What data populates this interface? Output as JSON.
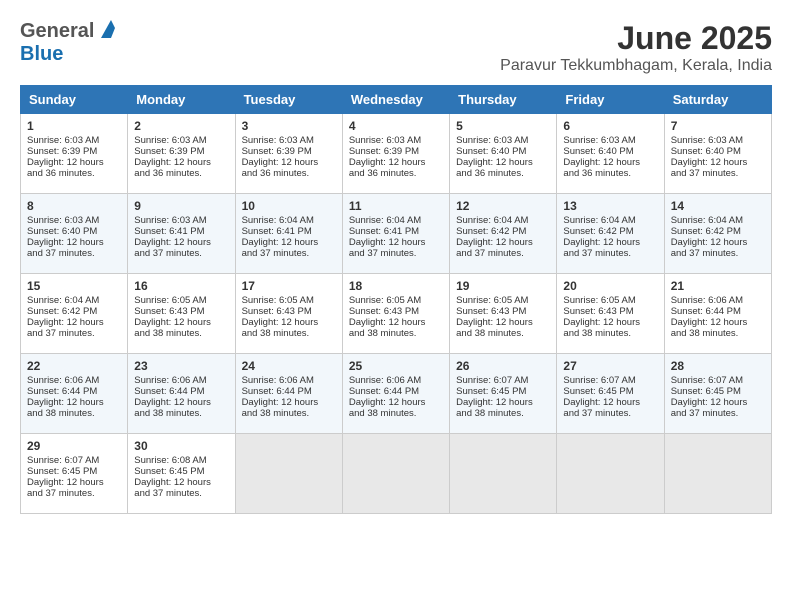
{
  "header": {
    "logo_general": "General",
    "logo_blue": "Blue",
    "title": "June 2025",
    "subtitle": "Paravur Tekkumbhagam, Kerala, India"
  },
  "weekdays": [
    "Sunday",
    "Monday",
    "Tuesday",
    "Wednesday",
    "Thursday",
    "Friday",
    "Saturday"
  ],
  "weeks": [
    [
      {
        "day": 1,
        "lines": [
          "Sunrise: 6:03 AM",
          "Sunset: 6:39 PM",
          "Daylight: 12 hours",
          "and 36 minutes."
        ]
      },
      {
        "day": 2,
        "lines": [
          "Sunrise: 6:03 AM",
          "Sunset: 6:39 PM",
          "Daylight: 12 hours",
          "and 36 minutes."
        ]
      },
      {
        "day": 3,
        "lines": [
          "Sunrise: 6:03 AM",
          "Sunset: 6:39 PM",
          "Daylight: 12 hours",
          "and 36 minutes."
        ]
      },
      {
        "day": 4,
        "lines": [
          "Sunrise: 6:03 AM",
          "Sunset: 6:39 PM",
          "Daylight: 12 hours",
          "and 36 minutes."
        ]
      },
      {
        "day": 5,
        "lines": [
          "Sunrise: 6:03 AM",
          "Sunset: 6:40 PM",
          "Daylight: 12 hours",
          "and 36 minutes."
        ]
      },
      {
        "day": 6,
        "lines": [
          "Sunrise: 6:03 AM",
          "Sunset: 6:40 PM",
          "Daylight: 12 hours",
          "and 36 minutes."
        ]
      },
      {
        "day": 7,
        "lines": [
          "Sunrise: 6:03 AM",
          "Sunset: 6:40 PM",
          "Daylight: 12 hours",
          "and 37 minutes."
        ]
      }
    ],
    [
      {
        "day": 8,
        "lines": [
          "Sunrise: 6:03 AM",
          "Sunset: 6:40 PM",
          "Daylight: 12 hours",
          "and 37 minutes."
        ]
      },
      {
        "day": 9,
        "lines": [
          "Sunrise: 6:03 AM",
          "Sunset: 6:41 PM",
          "Daylight: 12 hours",
          "and 37 minutes."
        ]
      },
      {
        "day": 10,
        "lines": [
          "Sunrise: 6:04 AM",
          "Sunset: 6:41 PM",
          "Daylight: 12 hours",
          "and 37 minutes."
        ]
      },
      {
        "day": 11,
        "lines": [
          "Sunrise: 6:04 AM",
          "Sunset: 6:41 PM",
          "Daylight: 12 hours",
          "and 37 minutes."
        ]
      },
      {
        "day": 12,
        "lines": [
          "Sunrise: 6:04 AM",
          "Sunset: 6:42 PM",
          "Daylight: 12 hours",
          "and 37 minutes."
        ]
      },
      {
        "day": 13,
        "lines": [
          "Sunrise: 6:04 AM",
          "Sunset: 6:42 PM",
          "Daylight: 12 hours",
          "and 37 minutes."
        ]
      },
      {
        "day": 14,
        "lines": [
          "Sunrise: 6:04 AM",
          "Sunset: 6:42 PM",
          "Daylight: 12 hours",
          "and 37 minutes."
        ]
      }
    ],
    [
      {
        "day": 15,
        "lines": [
          "Sunrise: 6:04 AM",
          "Sunset: 6:42 PM",
          "Daylight: 12 hours",
          "and 37 minutes."
        ]
      },
      {
        "day": 16,
        "lines": [
          "Sunrise: 6:05 AM",
          "Sunset: 6:43 PM",
          "Daylight: 12 hours",
          "and 38 minutes."
        ]
      },
      {
        "day": 17,
        "lines": [
          "Sunrise: 6:05 AM",
          "Sunset: 6:43 PM",
          "Daylight: 12 hours",
          "and 38 minutes."
        ]
      },
      {
        "day": 18,
        "lines": [
          "Sunrise: 6:05 AM",
          "Sunset: 6:43 PM",
          "Daylight: 12 hours",
          "and 38 minutes."
        ]
      },
      {
        "day": 19,
        "lines": [
          "Sunrise: 6:05 AM",
          "Sunset: 6:43 PM",
          "Daylight: 12 hours",
          "and 38 minutes."
        ]
      },
      {
        "day": 20,
        "lines": [
          "Sunrise: 6:05 AM",
          "Sunset: 6:43 PM",
          "Daylight: 12 hours",
          "and 38 minutes."
        ]
      },
      {
        "day": 21,
        "lines": [
          "Sunrise: 6:06 AM",
          "Sunset: 6:44 PM",
          "Daylight: 12 hours",
          "and 38 minutes."
        ]
      }
    ],
    [
      {
        "day": 22,
        "lines": [
          "Sunrise: 6:06 AM",
          "Sunset: 6:44 PM",
          "Daylight: 12 hours",
          "and 38 minutes."
        ]
      },
      {
        "day": 23,
        "lines": [
          "Sunrise: 6:06 AM",
          "Sunset: 6:44 PM",
          "Daylight: 12 hours",
          "and 38 minutes."
        ]
      },
      {
        "day": 24,
        "lines": [
          "Sunrise: 6:06 AM",
          "Sunset: 6:44 PM",
          "Daylight: 12 hours",
          "and 38 minutes."
        ]
      },
      {
        "day": 25,
        "lines": [
          "Sunrise: 6:06 AM",
          "Sunset: 6:44 PM",
          "Daylight: 12 hours",
          "and 38 minutes."
        ]
      },
      {
        "day": 26,
        "lines": [
          "Sunrise: 6:07 AM",
          "Sunset: 6:45 PM",
          "Daylight: 12 hours",
          "and 38 minutes."
        ]
      },
      {
        "day": 27,
        "lines": [
          "Sunrise: 6:07 AM",
          "Sunset: 6:45 PM",
          "Daylight: 12 hours",
          "and 37 minutes."
        ]
      },
      {
        "day": 28,
        "lines": [
          "Sunrise: 6:07 AM",
          "Sunset: 6:45 PM",
          "Daylight: 12 hours",
          "and 37 minutes."
        ]
      }
    ],
    [
      {
        "day": 29,
        "lines": [
          "Sunrise: 6:07 AM",
          "Sunset: 6:45 PM",
          "Daylight: 12 hours",
          "and 37 minutes."
        ]
      },
      {
        "day": 30,
        "lines": [
          "Sunrise: 6:08 AM",
          "Sunset: 6:45 PM",
          "Daylight: 12 hours",
          "and 37 minutes."
        ]
      },
      null,
      null,
      null,
      null,
      null
    ]
  ]
}
